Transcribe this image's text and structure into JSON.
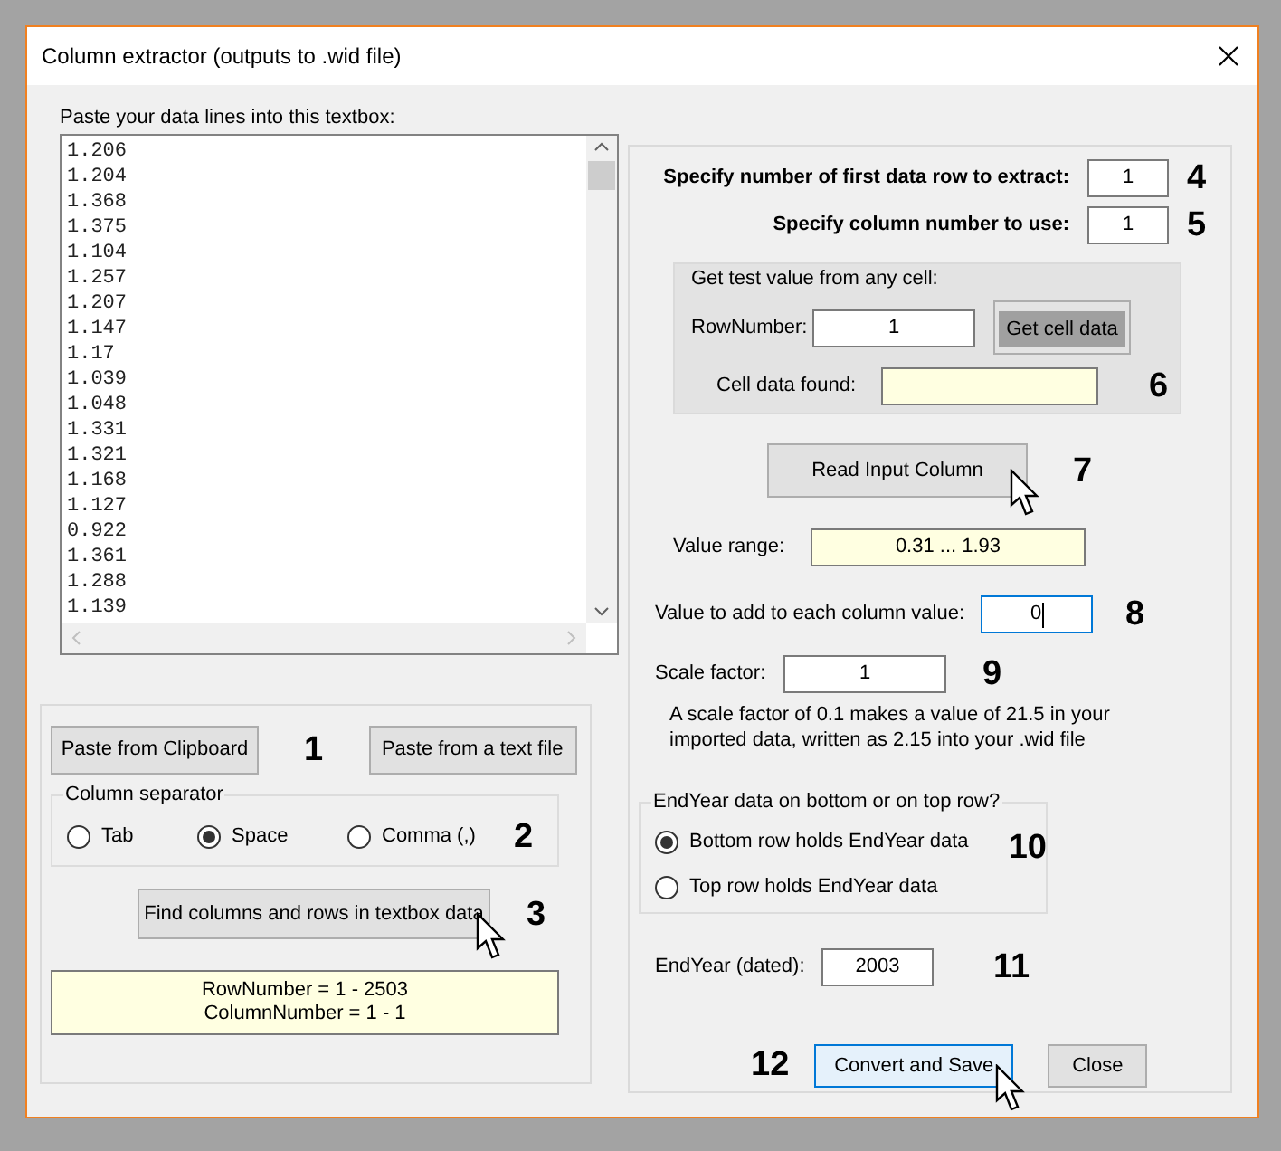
{
  "window": {
    "title": "Column extractor (outputs to .wid file)"
  },
  "data_box": {
    "label": "Paste your data lines into this textbox:",
    "lines": [
      "1.206",
      "1.204",
      "1.368",
      "1.375",
      "1.104",
      "1.257",
      "1.207",
      "1.147",
      "1.17",
      "1.039",
      "1.048",
      "1.331",
      "1.321",
      "1.168",
      "1.127",
      "0.922",
      "1.361",
      "1.288",
      "1.139"
    ]
  },
  "paste": {
    "buttons": [
      {
        "label": "Paste from Clipboard"
      },
      {
        "label": "Paste from a text file"
      }
    ],
    "step": "1"
  },
  "separator": {
    "legend": "Column separator",
    "step": "2",
    "options": [
      {
        "label": "Tab",
        "selected": false
      },
      {
        "label": "Space",
        "selected": true
      },
      {
        "label": "Comma (,)",
        "selected": false
      }
    ]
  },
  "find": {
    "label": "Find columns and rows in textbox data",
    "step": "3",
    "pointer": true
  },
  "result": {
    "lines": [
      "RowNumber = 1 - 2503",
      "ColumnNumber = 1 - 1"
    ]
  },
  "first_row": {
    "label": "Specify number of first data row to extract:",
    "value": "1",
    "step": "4"
  },
  "column": {
    "label": "Specify column number to use:",
    "value": "1",
    "step": "5"
  },
  "test_cell": {
    "legend": "Get test value from any cell:",
    "row_label": "RowNumber:",
    "row_value": "1",
    "button": "Get cell data",
    "found_label": "Cell data found:",
    "step": "6"
  },
  "read": {
    "label": "Read Input Column",
    "step": "7",
    "pointer": true
  },
  "value_range": {
    "label": "Value range:",
    "value": "0.31 ... 1.93"
  },
  "add_value": {
    "label": "Value to add to each column value:",
    "value": "0",
    "focused": true,
    "step": "8"
  },
  "scale": {
    "label": "Scale factor:",
    "value": "1",
    "step": "9",
    "note": "A scale factor of 0.1 makes a value of 21.5 in your imported data, written as 2.15 into your .wid file"
  },
  "end_year_row": {
    "legend": "EndYear data on bottom or on top row?",
    "step": "10",
    "options": [
      {
        "label": "Bottom row holds EndYear data",
        "selected": true
      },
      {
        "label": "Top row holds EndYear data",
        "selected": false
      }
    ]
  },
  "end_year": {
    "label": "EndYear (dated):",
    "value": "2003",
    "step": "11"
  },
  "actions": {
    "step": "12",
    "buttons": [
      {
        "label": "Convert and Save",
        "default": true,
        "pointer": true
      },
      {
        "label": "Close",
        "default": false,
        "pointer": false
      }
    ]
  }
}
